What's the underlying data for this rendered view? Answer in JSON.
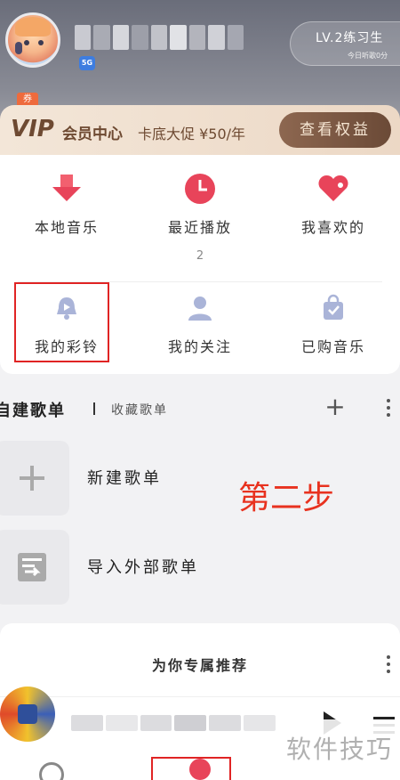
{
  "header": {
    "level_label": "LV.2练习生",
    "level_sub": "今日听歌0分",
    "network_badge": "5G",
    "coupon": "券"
  },
  "vip": {
    "logo": "VIP",
    "title": "会员中心",
    "promo": "卡底大促 ¥50/年",
    "button": "查看权益"
  },
  "quick_access": {
    "local_music": "本地音乐",
    "recent_play": "最近播放",
    "recent_count": "2",
    "favorites": "我喜欢的",
    "ringtones": "我的彩铃",
    "following": "我的关注",
    "purchased": "已购音乐"
  },
  "playlists": {
    "tab_own": "自建歌单",
    "tab_fav": "收藏歌单",
    "plus": "+",
    "new_playlist": "新建歌单",
    "import_playlist": "导入外部歌单"
  },
  "annotation": {
    "step": "第二步"
  },
  "recommend": {
    "title": "为你专属推荐"
  },
  "watermark": "软件技巧",
  "colors": {
    "accent": "#e8445a",
    "highlight": "#e02424",
    "vip_brown": "#6e4a32",
    "step_red": "#e8321f"
  }
}
